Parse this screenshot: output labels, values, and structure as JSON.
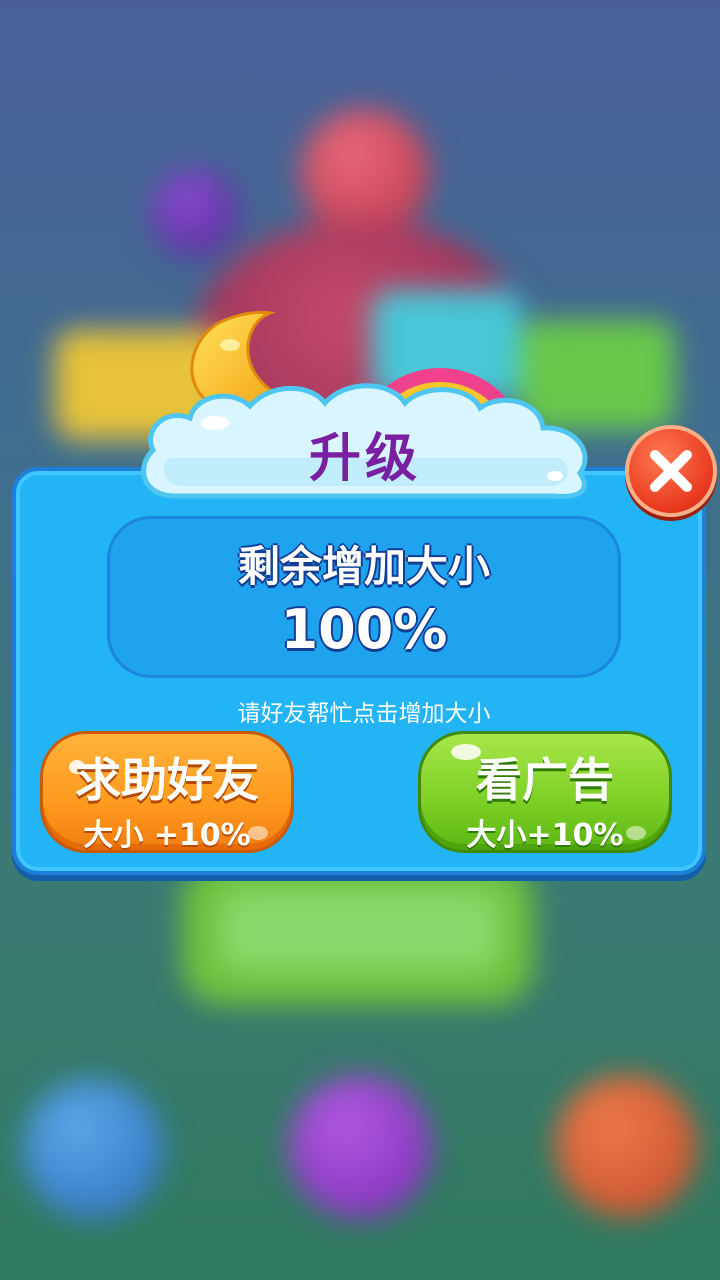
{
  "dialog": {
    "title": "升级",
    "info_label": "剩余增加大小",
    "info_value": "100%",
    "hint": "请好友帮忙点击增加大小"
  },
  "buttons": {
    "ask_friend_label": "求助好友",
    "ask_friend_bonus": "大小 +10%",
    "watch_ad_label": "看广告",
    "watch_ad_bonus": "大小+10%"
  },
  "colors": {
    "panel": "#22b4f4",
    "title": "#7a1fa2",
    "orange_button": "#ff9a1e",
    "green_button": "#7ccf24",
    "close_button": "#e8381e"
  },
  "icons": [
    "close-icon",
    "moon-icon",
    "rainbow-icon",
    "cloud-banner"
  ]
}
